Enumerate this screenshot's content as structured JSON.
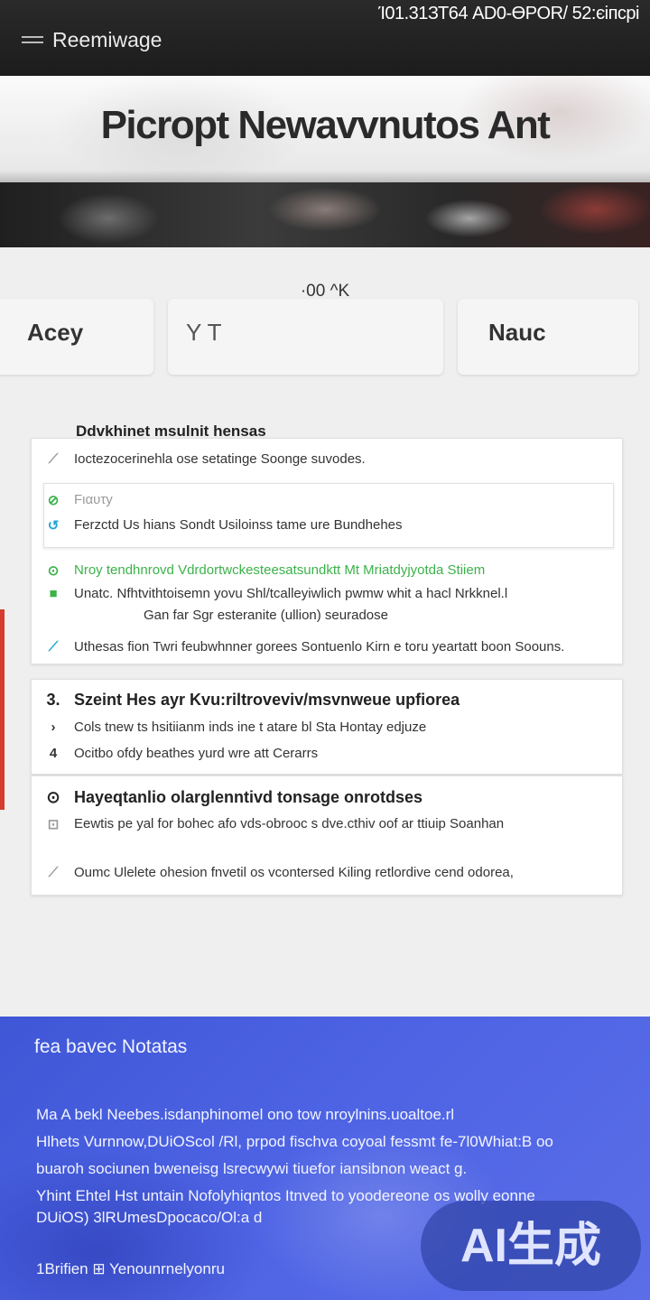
{
  "status_bar": {
    "text": "Ί01.31ЗТ64 АD0-ӨPОR/ 52:єіпсрі"
  },
  "app_bar": {
    "title": "Reemiwage",
    "menu_icon": "hamburger-menu-icon"
  },
  "hero": {
    "title": "Picropt Newavvnutos Ant"
  },
  "strip": {
    "label": "·00 ^K",
    "pills": [
      "Acey",
      "Y  T",
      "Nauc"
    ]
  },
  "section": {
    "heading": "Ddvkhinet msulnit hensas",
    "card1": {
      "row1": {
        "icon": "⟋",
        "text": "Ioctezocerinehla ose setatinge Soonge suvodes."
      },
      "inner": {
        "row1": {
          "icon": "⊘",
          "text": "Fιαυτy"
        },
        "row2": {
          "icon": "↺",
          "text": "Ferzctd Us hians Sondt Usiloinss tame ure Bundhehes"
        }
      },
      "row_green": {
        "icon": "⊙",
        "text": "Nroy tendhnrovd Vdrdortwckesteesatsundktt Mt Mriatdyjyotda Stiiem"
      },
      "row3": {
        "icon": "■",
        "text": "Unatc. Nfhtvithtoisemn yovu Shl/tcalleyiwlich pwmw whit a hacl Nrkknel.l"
      },
      "row3b": {
        "text": "Gan  far  Sgr esteranite (ullion)  seuradose"
      },
      "row4": {
        "icon": "⟋",
        "text": "Uthesas fion Twri feubwhnner gorees Sontuenlo Kirn e toru yeartatt boon Soouns."
      }
    },
    "card2": {
      "title": {
        "icon": "3.",
        "text": "Szeint Hes ayr Kvu:riltroveviv/msvnweue upfiorea"
      },
      "row1": {
        "icon": "›",
        "text": "Cols tnew ts hsitiianm inds ine t atare bl  Sta  Hontay edjuze"
      },
      "row2": {
        "icon": "4",
        "text": "Ocitbo ofdy beathes yurd wre att Cerarrs"
      }
    },
    "card3": {
      "title": {
        "icon": "⊙",
        "text": "Hayeqtanlio olarglenntivd tonsage onrotdses"
      },
      "row1": {
        "icon": "⊡",
        "text": "Eewtis pe yal for bohec afo vds-obrooc s dve.cthiv oof ar ttiuip Soanhan"
      },
      "row2": {
        "icon": "⟋",
        "text": "Oumc Ulelete ohesion fnvetil  os vcontersed Kiling retlordive cend odorea,"
      }
    }
  },
  "footer": {
    "title": "fea bavec Notatas",
    "lines": [
      "Ma A bekl Neebes.isdanphinomel ono tow nroylnins.uoaltoe.rl",
      "Hlhets Vurnnow,DUiOScol /Rl, prpod fischva coyoal fessmt fe-7l0Whiat:B oo",
      "buaroh sociunen bweneisg lsrecwywi tiuefor iansibnon weact g.",
      "Yhint Ehtel Hst untain Nofolyhiqntos Itnved  to yoodereone os wolly eonne",
      "DUiOS) 3lRUmesDpocaco/Ol:a d"
    ],
    "foot": "1Brifien  ⊞  Yenounrnelyonru"
  },
  "watermark": {
    "text": "AI生成"
  },
  "colors": {
    "accent_red": "#d33c2e",
    "green": "#3bb24a",
    "cyan": "#1fa3d6",
    "footer_blue": "#4d63e4"
  }
}
